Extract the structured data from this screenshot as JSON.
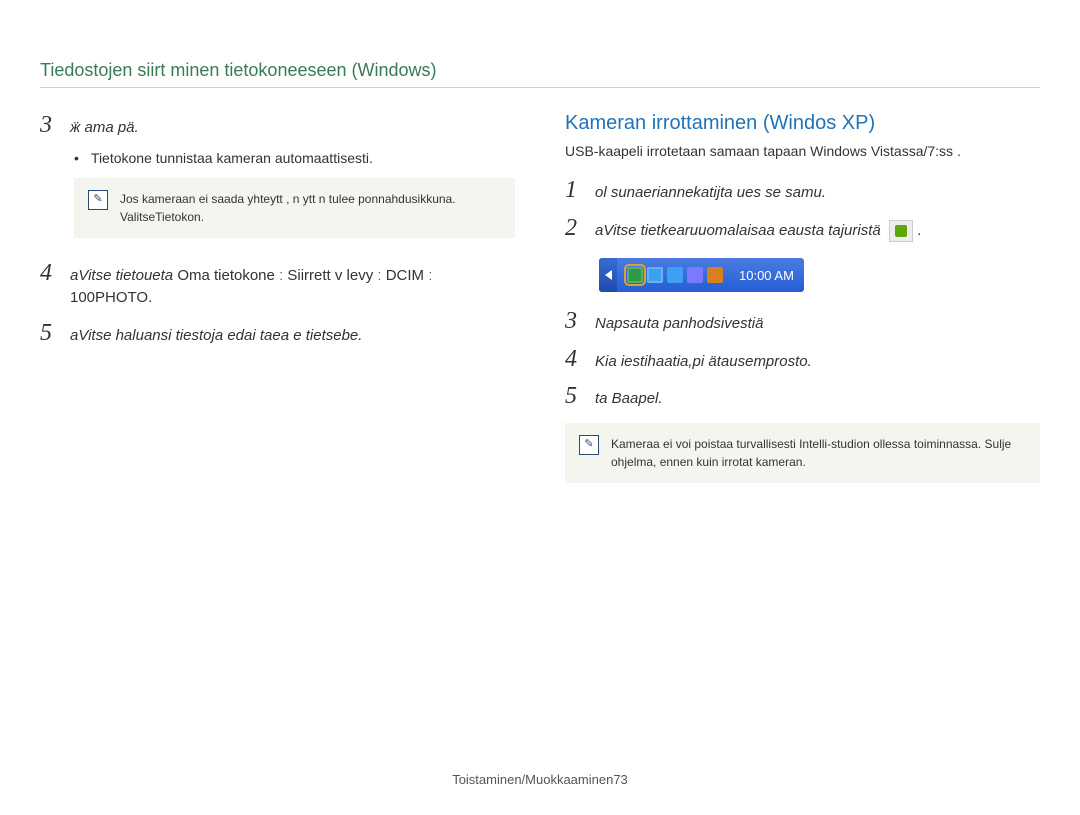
{
  "page_title": "Tiedostojen siirt minen tietokoneeseen (Windows)",
  "left": {
    "step3": {
      "num": "3",
      "text": "ӝ ama pä.",
      "sub": "Tietokone tunnistaa kameran automaattisesti.",
      "note": "Jos kameraan ei saada yhteytt , n ytt n tulee ponnahdusikkuna. ValitseTietokon."
    },
    "step4": {
      "num": "4",
      "text_italic": "aVitse tietoueta ",
      "text_after": "Oma tietokone ː Siirrett v levy ː DCIM ː 100PHOTO."
    },
    "step5": {
      "num": "5",
      "text": "aVitse haluansi tiestoja edai taea e tietsebe."
    }
  },
  "right": {
    "heading": "Kameran irrottaminen (Windos XP)",
    "desc": "USB-kaapeli irrotetaan samaan tapaan Windows Vistassa/7:ss .",
    "step1": {
      "num": "1",
      "text": "ol sunaeriannekatijta ues se samu."
    },
    "step2": {
      "num": "2",
      "text": "aVitse tietkearuuomalaisaa eausta tajuristä",
      "after_dot": "."
    },
    "tray_time": "10:00 AM",
    "step3": {
      "num": "3",
      "text": "Napsauta panhodsivestiä"
    },
    "step4": {
      "num": "4",
      "text": "Kia iestihaatia,pi ätausemprosto."
    },
    "step5": {
      "num": "5",
      "text": "ta Baapel."
    },
    "note": "Kameraa ei voi poistaa turvallisesti Intelli-studion ollessa toiminnassa. Sulje ohjelma, ennen kuin irrotat kameran."
  },
  "footer": "Toistaminen/Muokkaaminen73"
}
